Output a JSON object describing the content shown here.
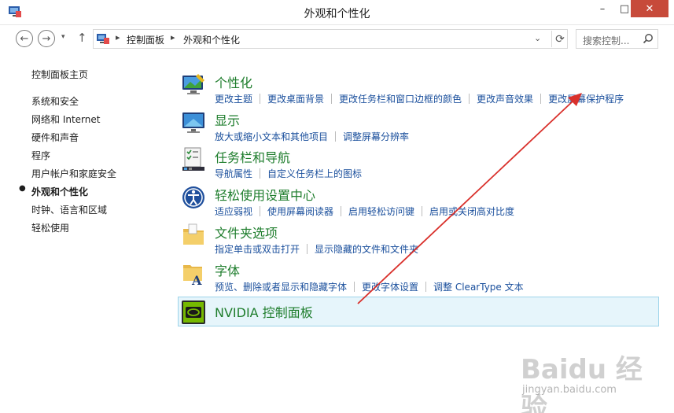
{
  "window": {
    "title": "外观和个性化",
    "minimize": "–",
    "maximize": "□",
    "close": "✕"
  },
  "navigation": {
    "back": "←",
    "forward": "→",
    "recent": "▾",
    "up": "↑"
  },
  "address": {
    "breadcrumb": [
      "控制面板",
      "外观和个性化"
    ],
    "separator": "▸",
    "dropdown": "⌄",
    "refresh": "⟳"
  },
  "search": {
    "placeholder": "搜索控制..."
  },
  "sidebar": {
    "home": "控制面板主页",
    "items": [
      {
        "label": "系统和安全",
        "active": false
      },
      {
        "label": "网络和 Internet",
        "active": false
      },
      {
        "label": "硬件和声音",
        "active": false
      },
      {
        "label": "程序",
        "active": false
      },
      {
        "label": "用户帐户和家庭安全",
        "active": false
      },
      {
        "label": "外观和个性化",
        "active": true
      },
      {
        "label": "时钟、语言和区域",
        "active": false
      },
      {
        "label": "轻松使用",
        "active": false
      }
    ],
    "bullet": "●"
  },
  "categories": [
    {
      "title": "个性化",
      "icon": "personalization-icon",
      "links": [
        "更改主题",
        "更改桌面背景",
        "更改任务栏和窗口边框的颜色",
        "更改声音效果",
        "更改屏幕保护程序"
      ]
    },
    {
      "title": "显示",
      "icon": "display-icon",
      "links": [
        "放大或缩小文本和其他项目",
        "调整屏幕分辨率"
      ]
    },
    {
      "title": "任务栏和导航",
      "icon": "taskbar-icon",
      "links": [
        "导航属性",
        "自定义任务栏上的图标"
      ]
    },
    {
      "title": "轻松使用设置中心",
      "icon": "ease-of-access-icon",
      "links": [
        "适应弱视",
        "使用屏幕阅读器",
        "启用轻松访问键",
        "启用或关闭高对比度"
      ]
    },
    {
      "title": "文件夹选项",
      "icon": "folder-options-icon",
      "links": [
        "指定单击或双击打开",
        "显示隐藏的文件和文件夹"
      ]
    },
    {
      "title": "字体",
      "icon": "fonts-icon",
      "links": [
        "预览、删除或者显示和隐藏字体",
        "更改字体设置",
        "调整 ClearType 文本"
      ]
    }
  ],
  "nvidia": {
    "title": "NVIDIA 控制面板",
    "icon": "nvidia-icon"
  },
  "watermark": {
    "brand": "Baidu 经验",
    "url": "jingyan.baidu.com"
  },
  "colors": {
    "category_title": "#1e7d2c",
    "link": "#1a4f9c",
    "highlight_bg": "#e6f5fb",
    "highlight_border": "#9ed4ea",
    "annotation_arrow": "#d9302b",
    "close_button": "#c74a3a"
  }
}
